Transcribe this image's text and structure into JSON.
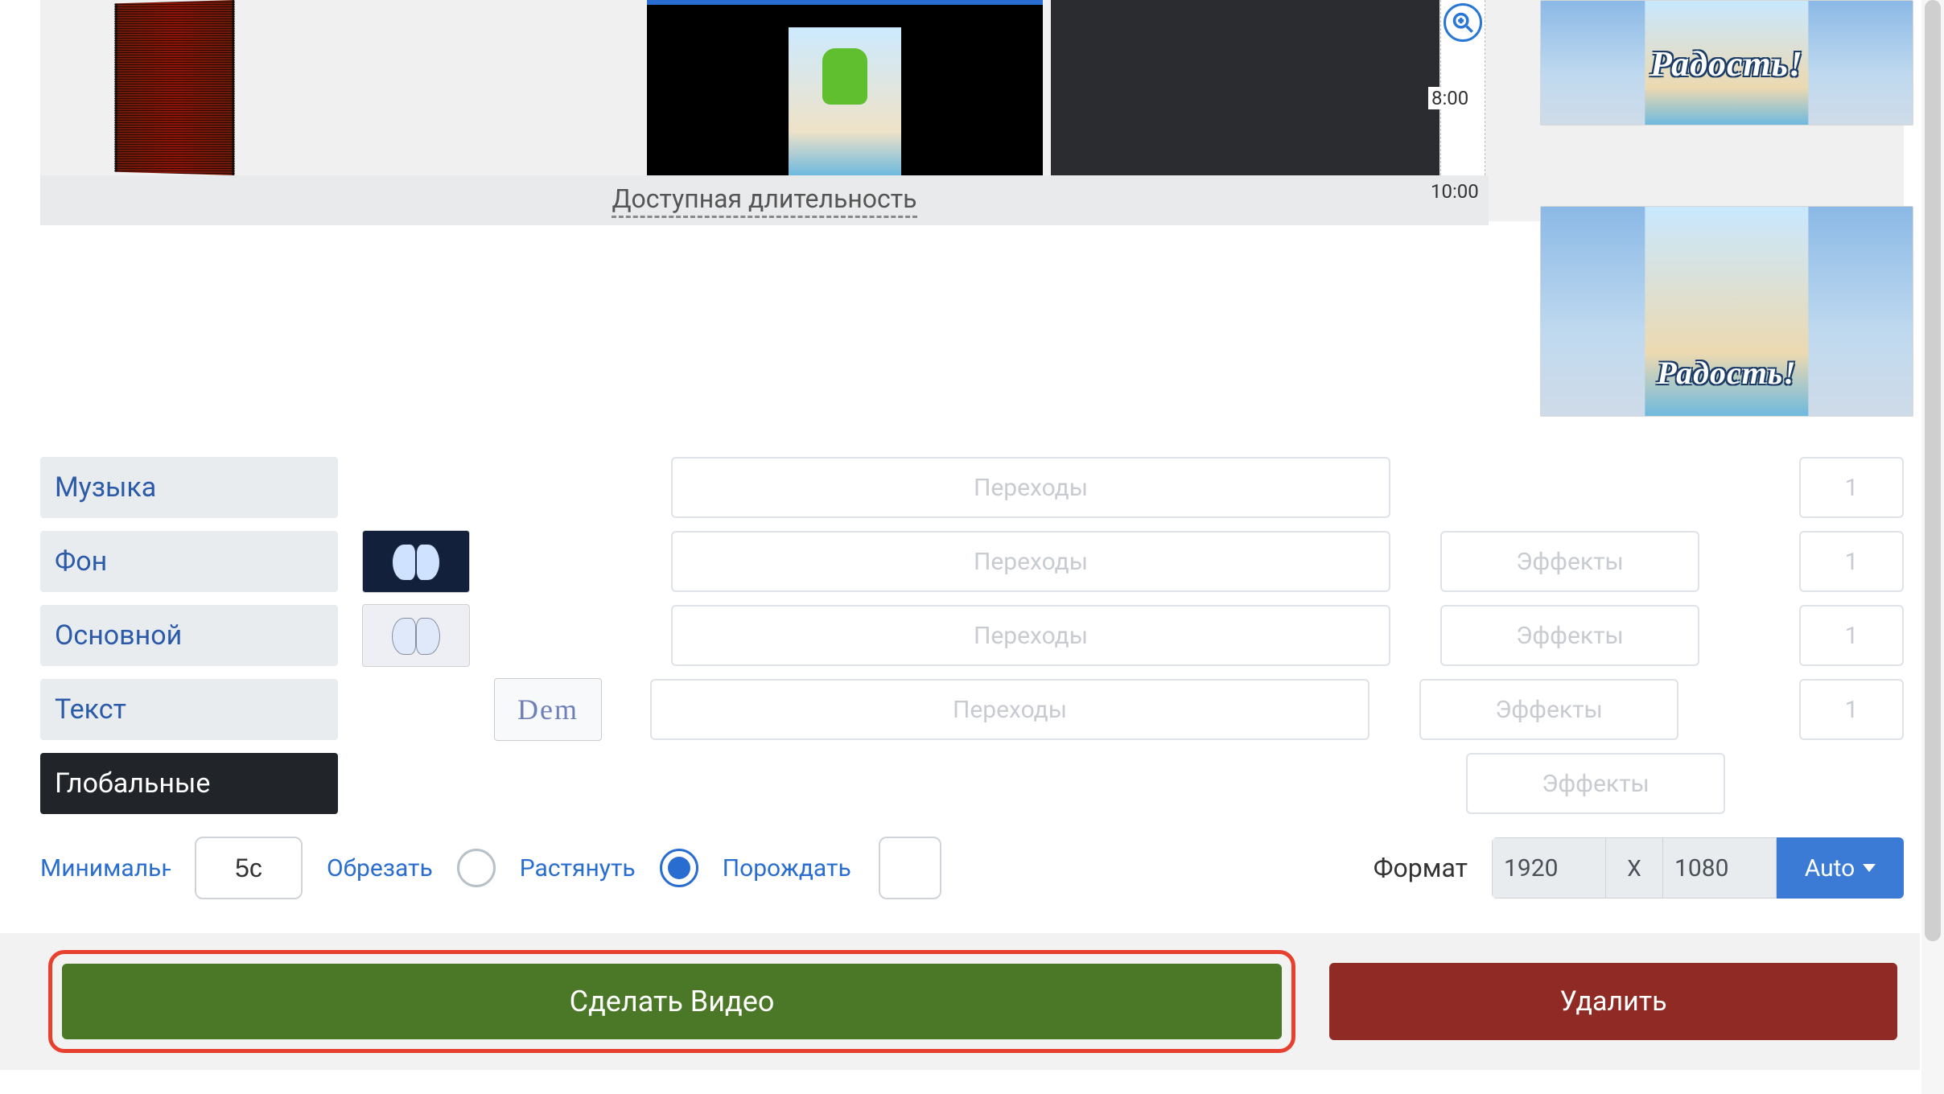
{
  "ruler": {
    "t1": "8:00",
    "t2": "10:00"
  },
  "duration_link": "Доступная длительность",
  "preview_caption": "Радость!",
  "rows": {
    "music": {
      "label": "Музыка",
      "transitions": "Переходы",
      "count": "1"
    },
    "bg": {
      "label": "Фон",
      "transitions": "Переходы",
      "effects": "Эффекты",
      "count": "1"
    },
    "main": {
      "label": "Основной",
      "transitions": "Переходы",
      "effects": "Эффекты",
      "count": "1"
    },
    "text": {
      "label": "Текст",
      "transitions": "Переходы",
      "effects": "Эффекты",
      "count": "1",
      "demo": "Dem"
    },
    "global": {
      "label": "Глобальные",
      "effects": "Эффекты"
    }
  },
  "controls": {
    "min_label": "Минимальн",
    "min_value": "5с",
    "crop_label": "Обрезать",
    "stretch_label": "Растянуть",
    "wait_label": "Порождать",
    "format_label": "Формат",
    "width": "1920",
    "x": "X",
    "height": "1080",
    "auto": "Auto"
  },
  "buttons": {
    "make": "Сделать Видео",
    "delete": "Удалить"
  }
}
